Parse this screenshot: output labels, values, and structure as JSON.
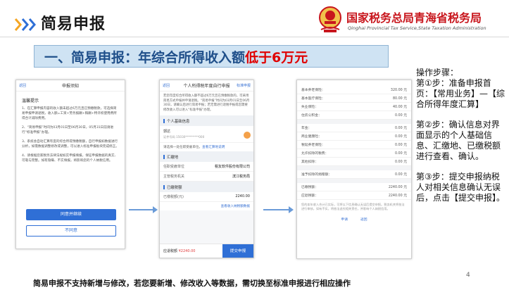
{
  "header": {
    "title": "简易申报",
    "org_cn": "国家税务总局青海省税务局",
    "org_en": "Qinghai Provincial Tax Service,State Taxation Administration"
  },
  "banner": {
    "main_text": "一、简易申报：年综合所得收入额",
    "highlight_text": "低于6万元"
  },
  "phone1": {
    "back_label": "返回",
    "title": "申报须知",
    "notice_title": "温馨提示",
    "notice_items": [
      "1、在汇算申报内容的收入额未超过6万元且已预缴税款，可选择简易申报申请退税，收入额=工资+劳务报酬+稿酬+特许权使用费所得合计减除费用。",
      "2、“简易申报”时间为03月01日至06月30日，05月31日前请进行“标准申报”办理。",
      "3、系统会自动汇算年度的综合所得预缴税额，自行申报如数据进行分析，如需数据调整修改或调整，可以进入标准申报板块完成修正。",
      "4、请根据您家税务法律法规如实申报填报，保证申报数据的真实、可靠与完整。如有隐瞒、不实填报，将影响您的个人纳税信用。"
    ],
    "agree_button": "同意并继续",
    "disagree_button": "不同意"
  },
  "phone2": {
    "back_label": "返回",
    "title": "个人所得税年度自行申报",
    "extra_label": "标准申报",
    "intro": "若您年度综合所得收入额不超过6万元且已预缴税款的，可采用简易方式申报并申请退税。“简易申报”时间为03月01日至06月30日，请确认后进行简易申报；若无需进行退税申报或您需要修改收入可以进入“标准申报”办理。",
    "section_basic": "个人基础信息",
    "name_label": "郭达",
    "id_label": "证件号码 15030*********000",
    "prompt_text": "请选择一处任职受雇单位，",
    "prompt_link": "查看汇算地说明",
    "section_summary": "汇缴地",
    "rows": [
      {
        "k": "任职受雇单位",
        "v": "税友软件股份有限公司"
      },
      {
        "k": "主管税务机关",
        "v": "滨江税务局"
      }
    ],
    "section_paid": "已缴税额",
    "paid_label": "已缴税额(元)",
    "paid_value": "2240.00",
    "view_link": "查看收入纳税额数据",
    "total_label": "应退税额",
    "total_value": "¥2240.00",
    "submit_button": "提交申报"
  },
  "phone3": {
    "rows_a": [
      {
        "k": "基本养老保险：",
        "v": "320.00 元"
      },
      {
        "k": "基本医疗保险：",
        "v": "80.00 元"
      },
      {
        "k": "失业保险：",
        "v": "40.00 元"
      },
      {
        "k": "住房公积金：",
        "v": "0.00 元"
      }
    ],
    "rows_b": [
      {
        "k": "年金：",
        "v": "0.00 元"
      },
      {
        "k": "商业健康险：",
        "v": "0.00 元"
      },
      {
        "k": "税延养老保险：",
        "v": "0.00 元"
      },
      {
        "k": "允许扣除的税费：",
        "v": "0.00 元"
      },
      {
        "k": "其他扣除：",
        "v": "0.00 元"
      }
    ],
    "rows_c": [
      {
        "k": "准予扣除的捐赠额：",
        "v": "0.00 元"
      }
    ],
    "rows_d": [
      {
        "k": "已缴税额：",
        "v": "2240.00 元"
      },
      {
        "k": "应退税额：",
        "v": "2240.00 元"
      }
    ],
    "note": "您的本年收入合计已实际，可将以下信息确认无误后提交申报。税务机关将依法进行审核，如有不实，将依法追究相关责任，并影响个人纳税信用。",
    "action_apply": "申请",
    "action_back": "返回"
  },
  "steps": {
    "heading": "操作步骤：",
    "step1": "第①步：准备申报首页：【常用业务】—【综合所得年度汇算】",
    "step2": "第②步：确认信息对界面显示的个人基础信息、汇缴地、已缴税额进行查看、确认。",
    "step3": "第③步：提交申报纳税人对相关信息确认无误后，点击【提交申报】。"
  },
  "page_number": "4",
  "footnote": "简易申报不支持新增与修改，若您要新增、修改收入等数据，需切换至标准申报进行相应操作"
}
